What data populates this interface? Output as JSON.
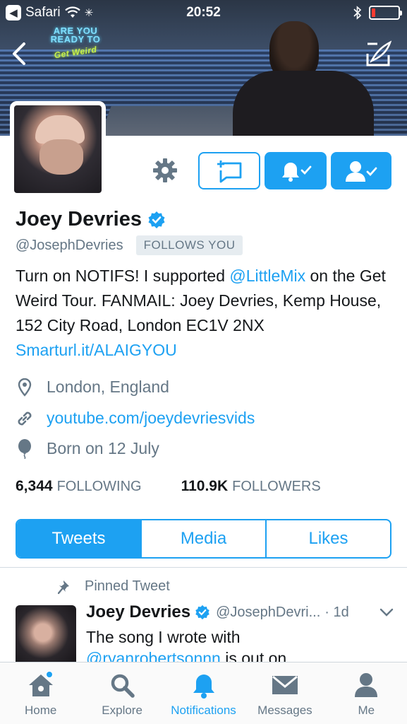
{
  "status_bar": {
    "back_app": "Safari",
    "time": "20:52",
    "battery_level": 0.15
  },
  "colors": {
    "accent": "#1da1f2",
    "text": "#14171a",
    "secondary": "#657786",
    "battery_low": "#ff3b30"
  },
  "banner": {
    "sign_line1": "ARE YOU",
    "sign_line2": "READY TO",
    "sign_line3": "Get Weird"
  },
  "icons": {
    "back": "chevron-left-icon",
    "compose": "compose-tweet-icon",
    "settings": "gear-icon",
    "dm": "direct-message-icon",
    "notify": "bell-check-icon",
    "follow": "following-person-icon",
    "verified": "verified-badge-icon",
    "location": "location-pin-icon",
    "link": "link-icon",
    "birthday": "balloon-icon",
    "pin": "pin-icon"
  },
  "profile": {
    "name": "Joey Devries",
    "handle": "@JosephDevries",
    "follows_badge": "FOLLOWS YOU",
    "bio": {
      "part1": "Turn on NOTIFS! I supported ",
      "mention": "@LittleMix",
      "part2": " on the Get Weird Tour. FANMAIL: Joey Devries, Kemp House, 152 City Road, London EC1V 2NX ",
      "link": "Smarturl.it/ALAIGYOU"
    },
    "location": "London, England",
    "website": "youtube.com/joeydevriesvids",
    "birthday": "Born on 12 July",
    "following_count": "6,344",
    "following_label": "FOLLOWING",
    "followers_count": "110.9K",
    "followers_label": "FOLLOWERS"
  },
  "segments": {
    "tweets": "Tweets",
    "media": "Media",
    "likes": "Likes"
  },
  "pinned_tweet": {
    "label": "Pinned Tweet",
    "name": "Joey Devries",
    "handle": "@JosephDevri...",
    "time": "· 1d",
    "text_line1": "The song I wrote with",
    "mention": "@ryanrobertsonnn",
    "text_rest": " is out on"
  },
  "tabbar": {
    "home": "Home",
    "explore": "Explore",
    "notifications": "Notifications",
    "messages": "Messages",
    "me": "Me"
  }
}
